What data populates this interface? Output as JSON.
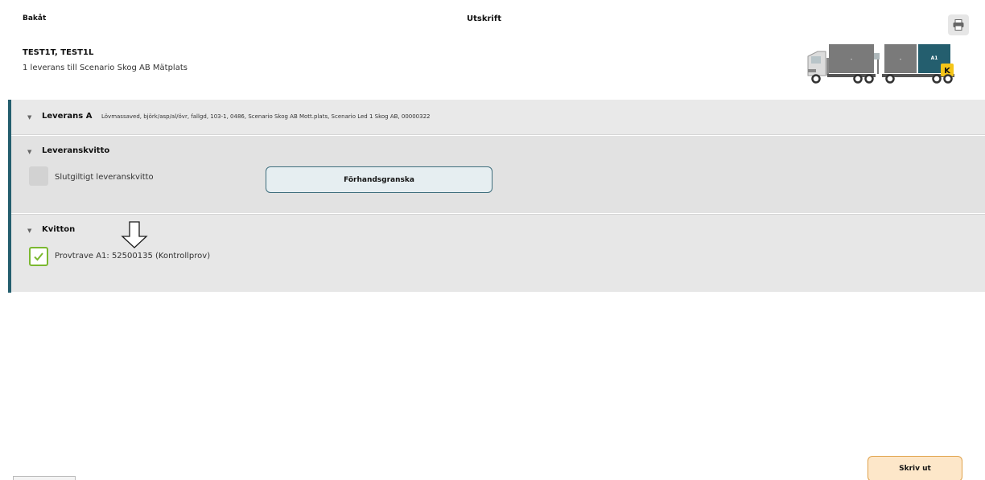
{
  "header": {
    "back_label": "Bakåt",
    "title": "Utskrift"
  },
  "vehicle": {
    "name": "TEST1T, TEST1L",
    "delivery_info": "1 leverans till Scenario Skog AB Mätplats",
    "load_1": "-",
    "load_2": "-",
    "load_3": "A1",
    "badge": "K"
  },
  "leverans": {
    "heading": "Leverans A",
    "detail": "Lövmassaved, björk/asp/al/övr, fallgd, 103-1, 0486, Scenario Skog AB Mott.plats, Scenario Led 1 Skog AB, 00000322"
  },
  "leveranskvitto": {
    "heading": "Leveranskvitto",
    "final_receipt_label": "Slutgiltigt leveranskvitto",
    "final_receipt_checked": false,
    "preview_button": "Förhandsgranska"
  },
  "kvitton": {
    "heading": "Kvitton",
    "items": [
      {
        "label": "Provtrave A1: 52500135 (Kontrollprov)",
        "checked": true
      }
    ]
  },
  "footer": {
    "print_button": "Skriv ut"
  },
  "colors": {
    "accent": "#245e6e",
    "check_green": "#7bb830",
    "print_button_bg": "#fde7c9",
    "print_button_border": "#e0a24a",
    "badge_yellow": "#f5c518"
  },
  "icons": {
    "print": "printer-icon",
    "triangle": "triangle-down-icon",
    "arrow": "arrow-down-outline-icon",
    "check": "check-icon",
    "vehicle": "truck-trailer-icon"
  }
}
